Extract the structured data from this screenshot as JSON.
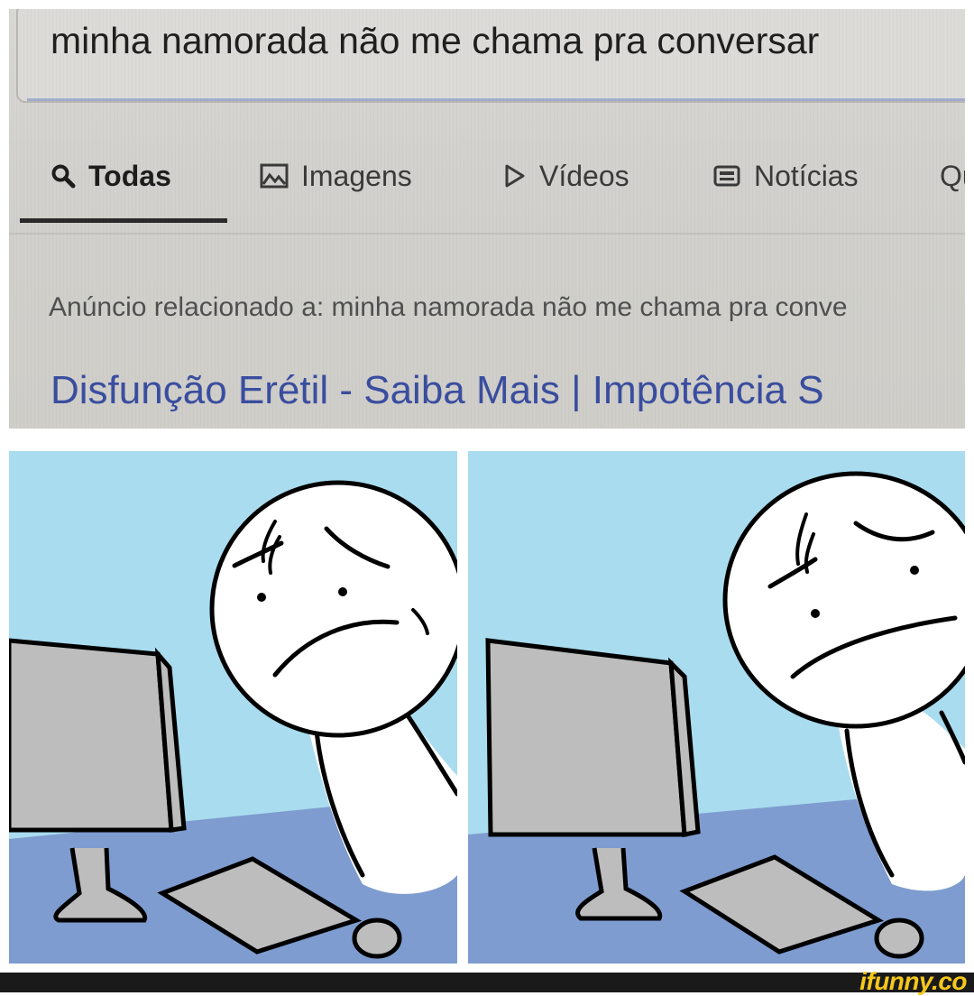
{
  "search": {
    "query": "minha namorada não me chama pra conversar"
  },
  "tabs": [
    {
      "label": "Todas",
      "icon": "search-icon",
      "active": true
    },
    {
      "label": "Imagens",
      "icon": "image-icon",
      "active": false
    },
    {
      "label": "Vídeos",
      "icon": "play-icon",
      "active": false
    },
    {
      "label": "Notícias",
      "icon": "newspaper-icon",
      "active": false
    },
    {
      "label": "Qu",
      "icon": "",
      "active": false
    }
  ],
  "results": {
    "ad_label": "Anúncio relacionado a: minha namorada não me chama pra conve",
    "ad_title": "Disfunção Erétil - Saiba Mais | Impotência S"
  },
  "footer": {
    "brand": "ifunny.co"
  },
  "colors": {
    "link": "#3a4ea0",
    "comic_sky": "#a9dcef",
    "comic_desk": "#7e9ccf",
    "monitor": "#bdbdbd",
    "brand": "#f6c81a"
  }
}
